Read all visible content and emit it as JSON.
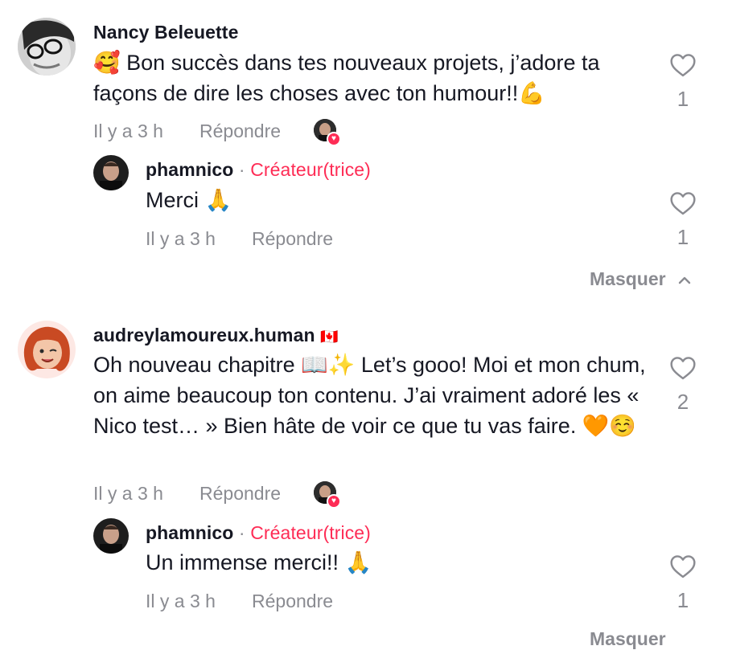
{
  "comments": [
    {
      "username": "Nancy Beleuette",
      "text": "🥰 Bon succès dans tes nouveaux projets, j’adore ta façons de dire les choses avec ton humour!!💪",
      "time": "Il y a 3 h",
      "reply_label": "Répondre",
      "likes": "1",
      "reply": {
        "username": "phamnico",
        "separator": "·",
        "creator_label": "Créateur(trice)",
        "text": "Merci 🙏",
        "time": "Il y a 3 h",
        "reply_label": "Répondre",
        "likes": "1"
      },
      "hide_label": "Masquer",
      "hide_icon": "chevron-up-icon"
    },
    {
      "username": "audreylamoureux.human",
      "flag": "🇨🇦",
      "text": "Oh nouveau chapitre 📖✨ Let’s gooo! Moi et mon chum, on aime beaucoup ton contenu. J’ai vraiment adoré les « Nico test… » Bien hâte de voir ce que tu vas faire. 🧡☺️",
      "time": "Il y a 3 h",
      "reply_label": "Répondre",
      "likes": "2",
      "reply": {
        "username": "phamnico",
        "separator": "·",
        "creator_label": "Créateur(trice)",
        "text": "Un immense merci!! 🙏",
        "time": "Il y a 3 h",
        "reply_label": "Répondre",
        "likes": "1"
      },
      "hide_label": "Masquer"
    }
  ],
  "colors": {
    "creator": "#fe2c55",
    "muted": "#8a8b91",
    "text": "#161823"
  }
}
